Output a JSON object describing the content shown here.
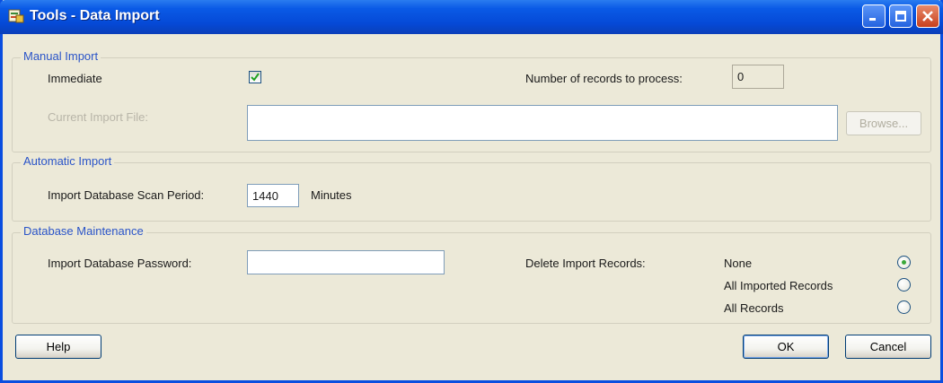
{
  "window": {
    "title": "Tools - Data Import",
    "colors": {
      "titlebar": "#0a5ae6",
      "face": "#ece9d8",
      "group_title": "#2a54c8",
      "close": "#c8401e"
    }
  },
  "manual_import": {
    "group_title": "Manual Import",
    "immediate_label": "Immediate",
    "immediate_checked": true,
    "records_label": "Number of records to process:",
    "records_value": "0",
    "current_file_label": "Current Import File:",
    "current_file_value": "",
    "browse_label": "Browse..."
  },
  "automatic_import": {
    "group_title": "Automatic Import",
    "scan_period_label": "Import Database Scan Period:",
    "scan_period_value": "1440",
    "scan_period_unit": "Minutes"
  },
  "database_maintenance": {
    "group_title": "Database Maintenance",
    "password_label": "Import Database Password:",
    "password_value": "",
    "delete_label": "Delete Import Records:",
    "delete_options": [
      {
        "label": "None",
        "selected": true
      },
      {
        "label": "All Imported Records",
        "selected": false
      },
      {
        "label": "All Records",
        "selected": false
      }
    ]
  },
  "footer": {
    "help_label": "Help",
    "ok_label": "OK",
    "cancel_label": "Cancel"
  }
}
